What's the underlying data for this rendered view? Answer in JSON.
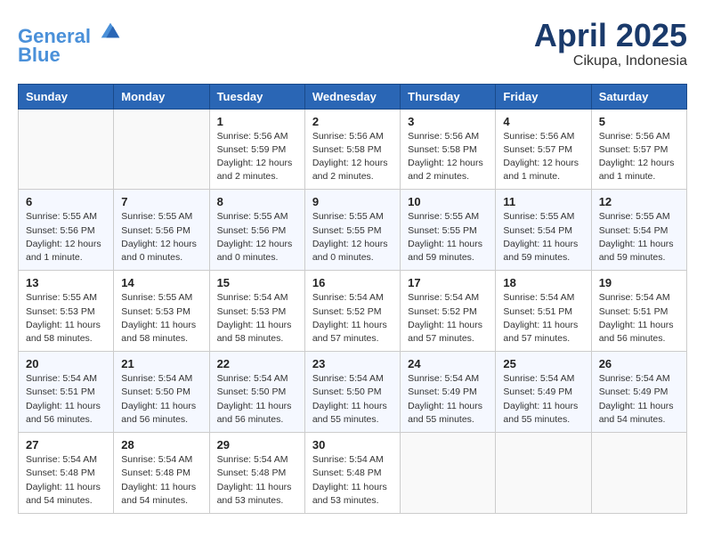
{
  "header": {
    "logo_line1": "General",
    "logo_line2": "Blue",
    "month_year": "April 2025",
    "location": "Cikupa, Indonesia"
  },
  "weekdays": [
    "Sunday",
    "Monday",
    "Tuesday",
    "Wednesday",
    "Thursday",
    "Friday",
    "Saturday"
  ],
  "weeks": [
    [
      {
        "day": "",
        "info": ""
      },
      {
        "day": "",
        "info": ""
      },
      {
        "day": "1",
        "info": "Sunrise: 5:56 AM\nSunset: 5:59 PM\nDaylight: 12 hours\nand 2 minutes."
      },
      {
        "day": "2",
        "info": "Sunrise: 5:56 AM\nSunset: 5:58 PM\nDaylight: 12 hours\nand 2 minutes."
      },
      {
        "day": "3",
        "info": "Sunrise: 5:56 AM\nSunset: 5:58 PM\nDaylight: 12 hours\nand 2 minutes."
      },
      {
        "day": "4",
        "info": "Sunrise: 5:56 AM\nSunset: 5:57 PM\nDaylight: 12 hours\nand 1 minute."
      },
      {
        "day": "5",
        "info": "Sunrise: 5:56 AM\nSunset: 5:57 PM\nDaylight: 12 hours\nand 1 minute."
      }
    ],
    [
      {
        "day": "6",
        "info": "Sunrise: 5:55 AM\nSunset: 5:56 PM\nDaylight: 12 hours\nand 1 minute."
      },
      {
        "day": "7",
        "info": "Sunrise: 5:55 AM\nSunset: 5:56 PM\nDaylight: 12 hours\nand 0 minutes."
      },
      {
        "day": "8",
        "info": "Sunrise: 5:55 AM\nSunset: 5:56 PM\nDaylight: 12 hours\nand 0 minutes."
      },
      {
        "day": "9",
        "info": "Sunrise: 5:55 AM\nSunset: 5:55 PM\nDaylight: 12 hours\nand 0 minutes."
      },
      {
        "day": "10",
        "info": "Sunrise: 5:55 AM\nSunset: 5:55 PM\nDaylight: 11 hours\nand 59 minutes."
      },
      {
        "day": "11",
        "info": "Sunrise: 5:55 AM\nSunset: 5:54 PM\nDaylight: 11 hours\nand 59 minutes."
      },
      {
        "day": "12",
        "info": "Sunrise: 5:55 AM\nSunset: 5:54 PM\nDaylight: 11 hours\nand 59 minutes."
      }
    ],
    [
      {
        "day": "13",
        "info": "Sunrise: 5:55 AM\nSunset: 5:53 PM\nDaylight: 11 hours\nand 58 minutes."
      },
      {
        "day": "14",
        "info": "Sunrise: 5:55 AM\nSunset: 5:53 PM\nDaylight: 11 hours\nand 58 minutes."
      },
      {
        "day": "15",
        "info": "Sunrise: 5:54 AM\nSunset: 5:53 PM\nDaylight: 11 hours\nand 58 minutes."
      },
      {
        "day": "16",
        "info": "Sunrise: 5:54 AM\nSunset: 5:52 PM\nDaylight: 11 hours\nand 57 minutes."
      },
      {
        "day": "17",
        "info": "Sunrise: 5:54 AM\nSunset: 5:52 PM\nDaylight: 11 hours\nand 57 minutes."
      },
      {
        "day": "18",
        "info": "Sunrise: 5:54 AM\nSunset: 5:51 PM\nDaylight: 11 hours\nand 57 minutes."
      },
      {
        "day": "19",
        "info": "Sunrise: 5:54 AM\nSunset: 5:51 PM\nDaylight: 11 hours\nand 56 minutes."
      }
    ],
    [
      {
        "day": "20",
        "info": "Sunrise: 5:54 AM\nSunset: 5:51 PM\nDaylight: 11 hours\nand 56 minutes."
      },
      {
        "day": "21",
        "info": "Sunrise: 5:54 AM\nSunset: 5:50 PM\nDaylight: 11 hours\nand 56 minutes."
      },
      {
        "day": "22",
        "info": "Sunrise: 5:54 AM\nSunset: 5:50 PM\nDaylight: 11 hours\nand 56 minutes."
      },
      {
        "day": "23",
        "info": "Sunrise: 5:54 AM\nSunset: 5:50 PM\nDaylight: 11 hours\nand 55 minutes."
      },
      {
        "day": "24",
        "info": "Sunrise: 5:54 AM\nSunset: 5:49 PM\nDaylight: 11 hours\nand 55 minutes."
      },
      {
        "day": "25",
        "info": "Sunrise: 5:54 AM\nSunset: 5:49 PM\nDaylight: 11 hours\nand 55 minutes."
      },
      {
        "day": "26",
        "info": "Sunrise: 5:54 AM\nSunset: 5:49 PM\nDaylight: 11 hours\nand 54 minutes."
      }
    ],
    [
      {
        "day": "27",
        "info": "Sunrise: 5:54 AM\nSunset: 5:48 PM\nDaylight: 11 hours\nand 54 minutes."
      },
      {
        "day": "28",
        "info": "Sunrise: 5:54 AM\nSunset: 5:48 PM\nDaylight: 11 hours\nand 54 minutes."
      },
      {
        "day": "29",
        "info": "Sunrise: 5:54 AM\nSunset: 5:48 PM\nDaylight: 11 hours\nand 53 minutes."
      },
      {
        "day": "30",
        "info": "Sunrise: 5:54 AM\nSunset: 5:48 PM\nDaylight: 11 hours\nand 53 minutes."
      },
      {
        "day": "",
        "info": ""
      },
      {
        "day": "",
        "info": ""
      },
      {
        "day": "",
        "info": ""
      }
    ]
  ]
}
